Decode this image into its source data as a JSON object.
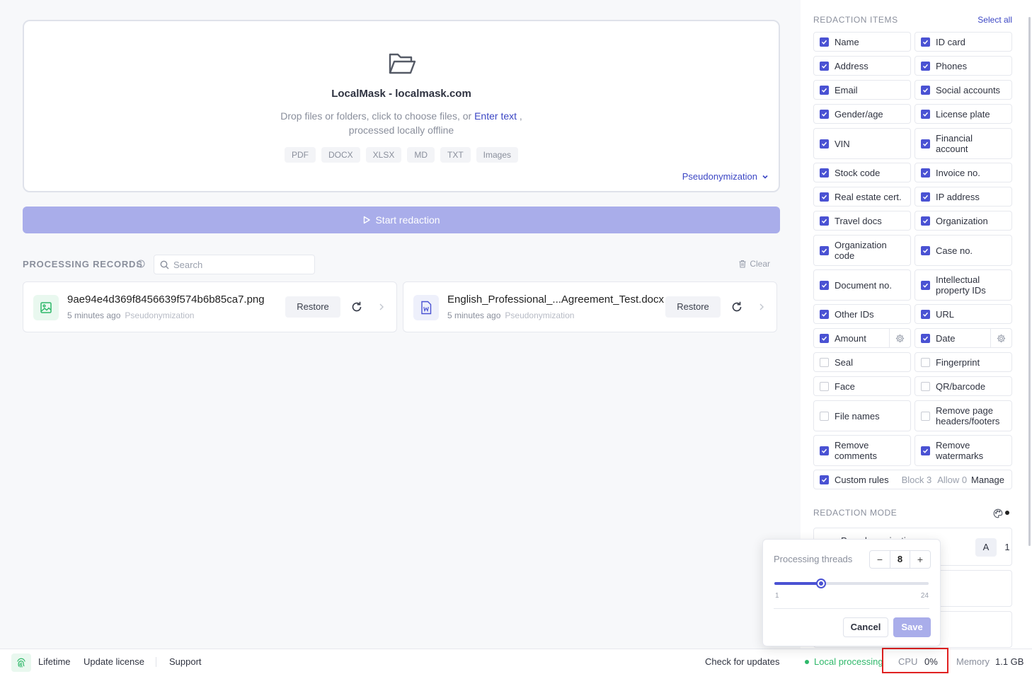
{
  "dropzone": {
    "app_title": "LocalMask - localmask.com",
    "desc_before": "Drop files or folders, click to choose files, or ",
    "desc_link": "Enter text",
    "desc_after": " ,",
    "desc_line2": "processed locally offline",
    "formats": [
      "PDF",
      "DOCX",
      "XLSX",
      "MD",
      "TXT",
      "Images"
    ],
    "mode": "Pseudonymization"
  },
  "start_button": "Start redaction",
  "records": {
    "title": "PROCESSING RECORDS",
    "search_placeholder": "Search",
    "clear_label": "Clear",
    "items": [
      {
        "name": "9ae94e4d369f8456639f574b6b85ca7.png",
        "time": "5 minutes ago",
        "mode": "Pseudonymization",
        "restore": "Restore",
        "type": "image"
      },
      {
        "name": "English_Professional_...Agreement_Test.docx",
        "time": "5 minutes ago",
        "mode": "Pseudonymization",
        "restore": "Restore",
        "type": "docx"
      }
    ]
  },
  "sidebar": {
    "items_title": "REDACTION ITEMS",
    "select_all": "Select all",
    "items": [
      {
        "label": "Name",
        "checked": true
      },
      {
        "label": "ID card",
        "checked": true
      },
      {
        "label": "Address",
        "checked": true
      },
      {
        "label": "Phones",
        "checked": true
      },
      {
        "label": "Email",
        "checked": true
      },
      {
        "label": "Social accounts",
        "checked": true
      },
      {
        "label": "Gender/age",
        "checked": true
      },
      {
        "label": "License plate",
        "checked": true
      },
      {
        "label": "VIN",
        "checked": true
      },
      {
        "label": "Financial account",
        "checked": true
      },
      {
        "label": "Stock code",
        "checked": true
      },
      {
        "label": "Invoice no.",
        "checked": true
      },
      {
        "label": "Real estate cert.",
        "checked": true
      },
      {
        "label": "IP address",
        "checked": true
      },
      {
        "label": "Travel docs",
        "checked": true
      },
      {
        "label": "Organization",
        "checked": true
      },
      {
        "label": "Organization code",
        "checked": true
      },
      {
        "label": "Case no.",
        "checked": true
      },
      {
        "label": "Document no.",
        "checked": true
      },
      {
        "label": "Intellectual property IDs",
        "checked": true
      },
      {
        "label": "Other IDs",
        "checked": true
      },
      {
        "label": "URL",
        "checked": true
      },
      {
        "label": "Amount",
        "checked": true
      },
      {
        "label": "Date",
        "checked": true
      },
      {
        "label": "Seal",
        "checked": false
      },
      {
        "label": "Fingerprint",
        "checked": false
      },
      {
        "label": "Face",
        "checked": false
      },
      {
        "label": "QR/barcode",
        "checked": false
      },
      {
        "label": "File names",
        "checked": false
      },
      {
        "label": "Remove page headers/footers",
        "checked": false
      },
      {
        "label": "Remove comments",
        "checked": true
      },
      {
        "label": "Remove watermarks",
        "checked": true
      }
    ],
    "custom_rules": {
      "label": "Custom rules",
      "block": "Block 3",
      "allow": "Allow 0",
      "manage": "Manage",
      "checked": true
    },
    "mode_title": "REDACTION MODE",
    "mode_option": "Pseudonymization",
    "mode_a": "A",
    "mode_1": "1"
  },
  "popover": {
    "label": "Processing threads",
    "value": "8",
    "minus": "−",
    "plus": "+",
    "min": "1",
    "max": "24",
    "slider_fraction": 0.3043,
    "cancel": "Cancel",
    "save": "Save"
  },
  "footer": {
    "lifetime": "Lifetime",
    "update_license": "Update license",
    "support": "Support",
    "check_updates": "Check for updates",
    "local_processing": "Local processing",
    "cpu_label": "CPU",
    "cpu_value": "0%",
    "memory_label": "Memory",
    "memory_value": "1.1 GB"
  },
  "colors": {
    "accent": "#4a52d3",
    "accent_light": "#a9adea",
    "green": "#2fb86a",
    "highlight": "#e02020"
  }
}
